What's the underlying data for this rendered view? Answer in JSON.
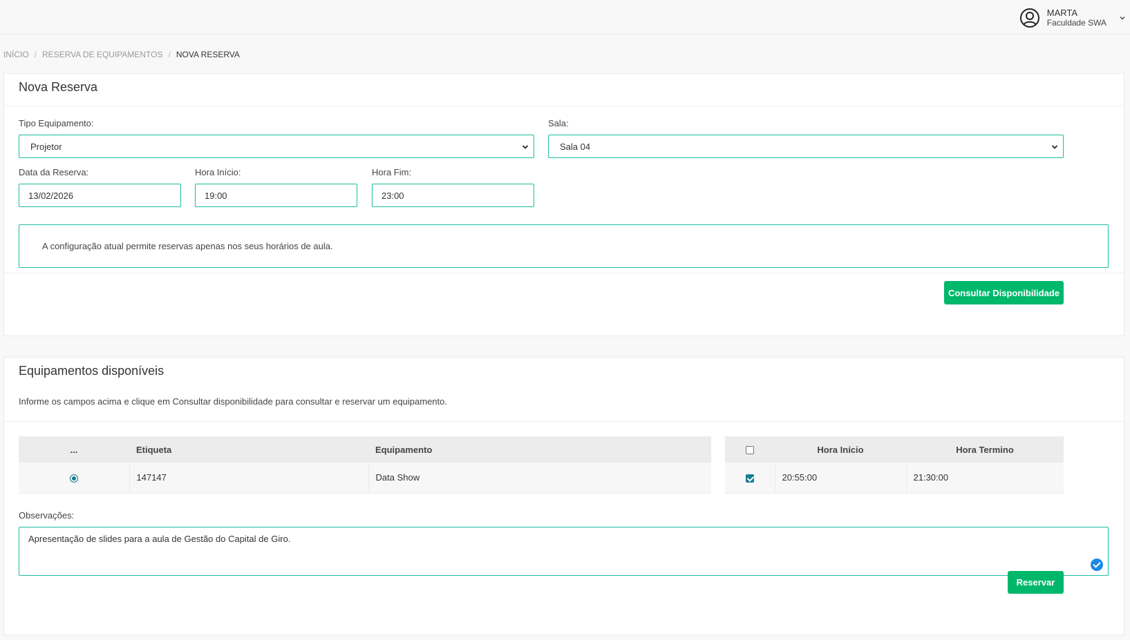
{
  "user": {
    "name": "MARTA",
    "org": "Faculdade SWA"
  },
  "breadcrumb": [
    "INÍCIO",
    "RESERVA DE EQUIPAMENTOS",
    "NOVA RESERVA"
  ],
  "form": {
    "title": "Nova Reserva",
    "tipo_label": "Tipo Equipamento:",
    "tipo_value": "Projetor",
    "sala_label": "Sala:",
    "sala_value": "Sala 04",
    "data_label": "Data da Reserva:",
    "data_value": "13/02/2026",
    "inicio_label": "Hora Início:",
    "inicio_value": "19:00",
    "fim_label": "Hora Fim:",
    "fim_value": "23:00",
    "info": "A configuração atual permite reservas apenas nos seus horários de aula.",
    "consultar_label": "Consultar Disponibilidade"
  },
  "equipamentos": {
    "title": "Equipamentos disponíveis",
    "description": "Informe os campos acima e clique em Consultar disponibilidade para consultar e reservar um equipamento.",
    "table": {
      "headers": [
        "...",
        "Etiqueta",
        "Equipamento"
      ],
      "rows": [
        {
          "etiqueta": "147147",
          "equipamento": "Data Show",
          "selected": true
        }
      ]
    },
    "horarios": {
      "headers": [
        "Hora Início",
        "Hora Termino"
      ],
      "rows": [
        {
          "inicio": "20:55:00",
          "termino": "21:30:00",
          "checked": true
        }
      ]
    },
    "obs_label": "Observações:",
    "obs_value": "Apresentação de slides para a aula de Gestão do Capital de Giro.",
    "reservar_label": "Reservar"
  },
  "colors": {
    "accent": "#1abc9c",
    "button": "#00b86b",
    "radio": "#167d94",
    "check_badge": "#1e88e5"
  }
}
